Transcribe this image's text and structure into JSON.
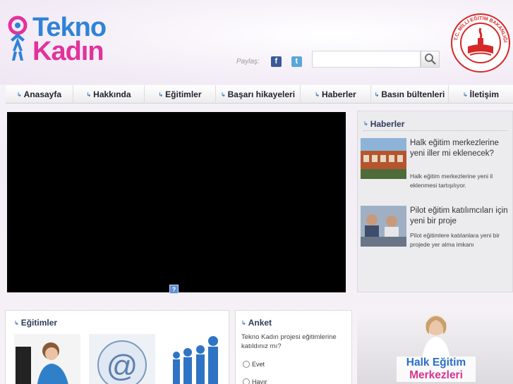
{
  "header": {
    "logo_line1": "Tekno",
    "logo_line2": "Kadın",
    "seal_text": "T.C. MİLLİ EĞİTİM BAKANLIĞI",
    "share_label": "Paylaş:",
    "share_icons": [
      "facebook-icon",
      "twitter-icon",
      "friendfeed-icon"
    ],
    "search_placeholder": ""
  },
  "nav": {
    "items": [
      {
        "label": "Anasayfa"
      },
      {
        "label": "Hakkında"
      },
      {
        "label": "Eğitimler"
      },
      {
        "label": "Başarı hikayeleri"
      },
      {
        "label": "Haberler"
      },
      {
        "label": "Basın bültenleri"
      },
      {
        "label": "İletişim"
      }
    ]
  },
  "news": {
    "title": "Haberler",
    "items": [
      {
        "title": "Halk eğitim merkezlerine yeni iller mi eklenecek?",
        "desc": "Halk eğitim merkezlerine yeni il eklenmesi tartışılıyor."
      },
      {
        "title": "Pilot eğitim katılımcıları için yeni bir proje",
        "desc": "Pilot eğitimlere katılanlara yeni bir projede yer alma imkanı"
      }
    ]
  },
  "education": {
    "title": "Eğitimler"
  },
  "poll": {
    "title": "Anket",
    "question": "Tekno Kadın projesi eğitimlerine katıldınız mı?",
    "options": [
      "Evet",
      "Hayır"
    ]
  },
  "promo": {
    "line1": "Halk Eğitim",
    "line2": "Merkezleri"
  },
  "colors": {
    "brand_blue": "#2f83d8",
    "brand_pink": "#e2329c",
    "seal_red": "#d62828"
  }
}
